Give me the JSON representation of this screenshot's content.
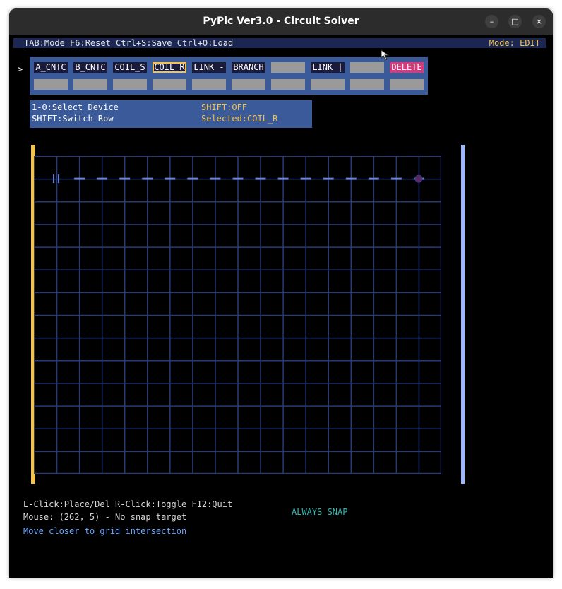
{
  "window": {
    "title": "PyPlc Ver3.0 - Circuit Solver",
    "controls": {
      "minimize": "–",
      "maximize": "□",
      "close": "×"
    }
  },
  "topbar": {
    "hint": "TAB:Mode F6:Reset Ctrl+S:Save Ctrl+O:Load",
    "mode": "Mode: EDIT"
  },
  "palette": {
    "row_indicator": ">",
    "row1": [
      "A_CNTC",
      "B_CNTC",
      "COIL_S",
      "COIL_R",
      "LINK -",
      "BRANCH",
      "",
      "LINK |",
      "",
      "DELETE"
    ],
    "row2": [
      "",
      "",
      "",
      "",
      "",
      "",
      "",
      "",
      "",
      ""
    ],
    "selected_index": 3
  },
  "info": {
    "line1": "1-0:Select Device",
    "line2": "SHIFT:Switch Row",
    "shift": "SHIFT:OFF",
    "selected": "Selected:COIL_R"
  },
  "canvas": {
    "columns": 18,
    "rows": 14,
    "placed": [
      {
        "device": "contact",
        "col": 1,
        "row": 1
      },
      {
        "device": "link",
        "col": 2,
        "row": 1
      },
      {
        "device": "link",
        "col": 3,
        "row": 1
      },
      {
        "device": "link",
        "col": 4,
        "row": 1
      },
      {
        "device": "link",
        "col": 5,
        "row": 1
      },
      {
        "device": "link",
        "col": 6,
        "row": 1
      },
      {
        "device": "link",
        "col": 7,
        "row": 1
      },
      {
        "device": "link",
        "col": 8,
        "row": 1
      },
      {
        "device": "link",
        "col": 9,
        "row": 1
      },
      {
        "device": "link",
        "col": 10,
        "row": 1
      },
      {
        "device": "link",
        "col": 11,
        "row": 1
      },
      {
        "device": "link",
        "col": 12,
        "row": 1
      },
      {
        "device": "link",
        "col": 13,
        "row": 1
      },
      {
        "device": "link",
        "col": 14,
        "row": 1
      },
      {
        "device": "link",
        "col": 15,
        "row": 1
      },
      {
        "device": "link",
        "col": 16,
        "row": 1
      },
      {
        "device": "link",
        "col": 17,
        "row": 1
      },
      {
        "device": "node",
        "col": 17,
        "row": 1
      }
    ]
  },
  "footer": {
    "controls": "L-Click:Place/Del R-Click:Toggle F12:Quit",
    "mouse": "Mouse: (262, 5) - No snap target",
    "advice": "Move closer to grid intersection",
    "snap_mode": "ALWAYS SNAP"
  },
  "colors": {
    "window_bg": "#000000",
    "topbar_bg": "#1b2752",
    "panel_bg": "#3a5a99",
    "accent_yellow": "#f2c34e",
    "delete_pink": "#d63a7a",
    "grid_line": "#2a3a78",
    "link": "#6a86d8",
    "right_rail": "#9db7ff",
    "snap_teal": "#38b7b0",
    "advice_blue": "#6aa8ff"
  }
}
